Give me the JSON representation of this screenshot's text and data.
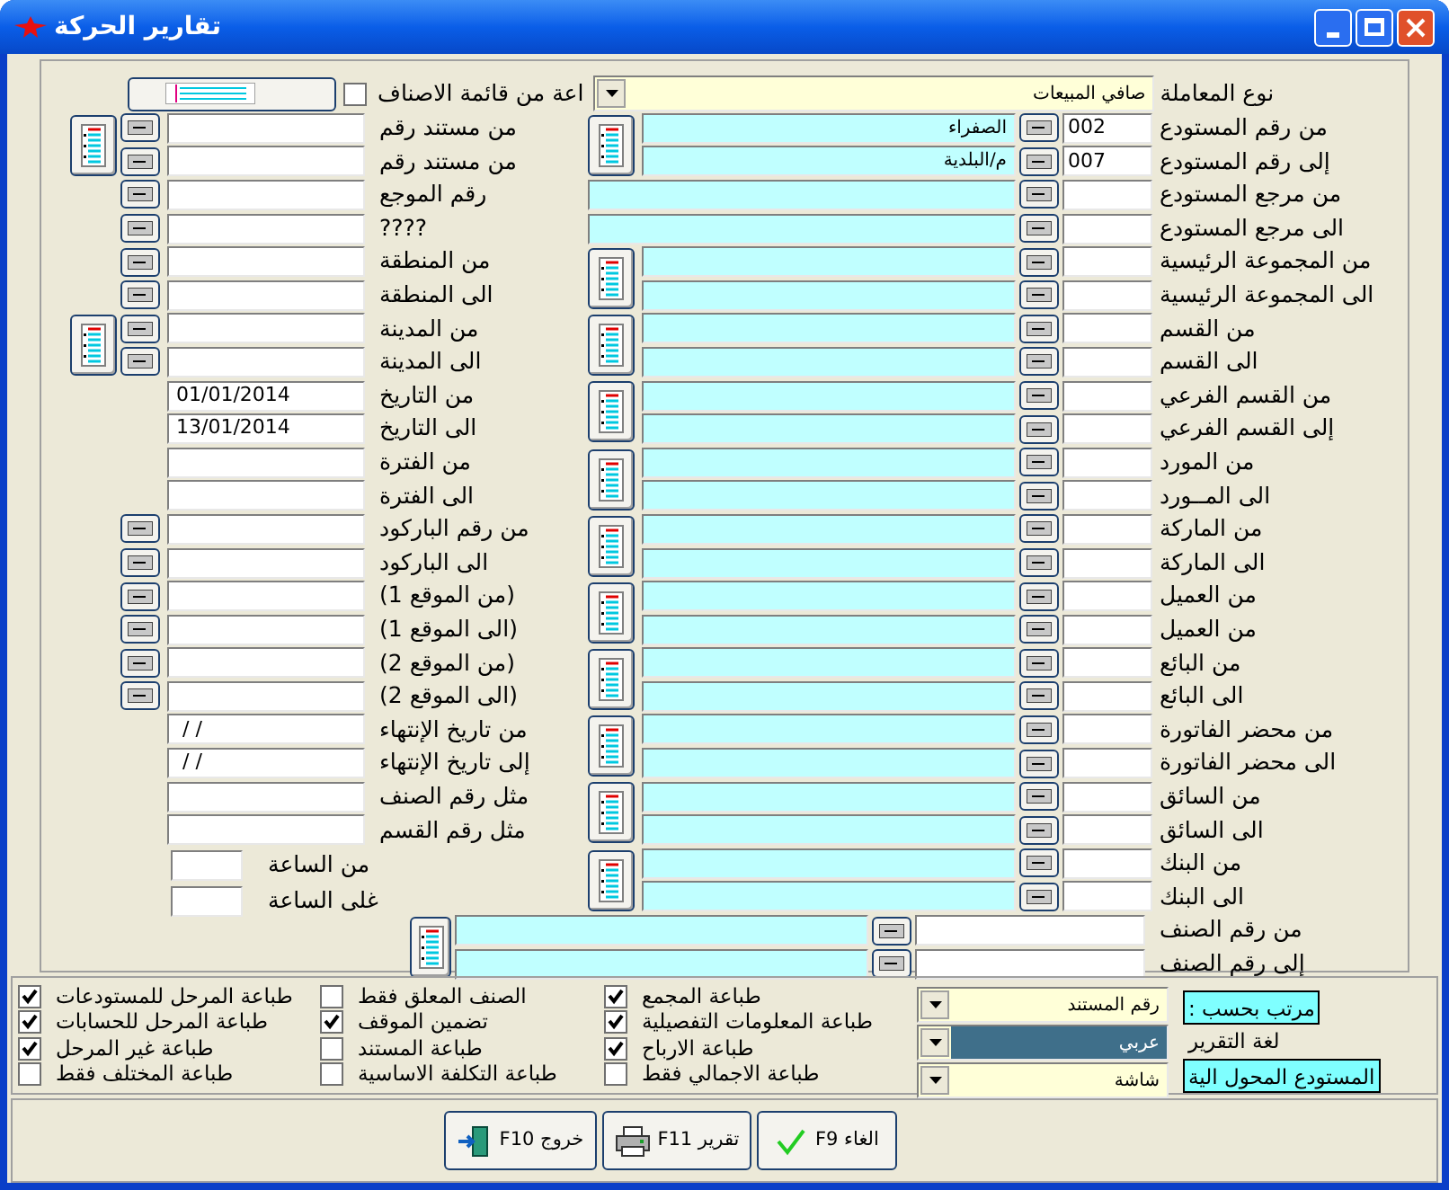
{
  "window": {
    "title": "تقارير الحركة"
  },
  "items_list": {
    "label": "اعة من قائمة الاصناف",
    "checked": false
  },
  "transaction_type": {
    "label": "نوع المعاملة",
    "value": "صافي المبيعات"
  },
  "left_groups": [
    {
      "list_button": true,
      "rows": [
        {
          "label": "من مستند رقم",
          "lookup": true
        },
        {
          "label": "من مستند رقم",
          "lookup": true
        }
      ]
    },
    {
      "list_button": false,
      "rows": [
        {
          "label": "رقم الموجع",
          "lookup": true
        },
        {
          "label": "????",
          "lookup": true
        }
      ]
    },
    {
      "list_button": false,
      "rows": [
        {
          "label": "من المنطقة",
          "lookup": true
        },
        {
          "label": "الى المنطقة",
          "lookup": true
        }
      ]
    },
    {
      "list_button": true,
      "rows": [
        {
          "label": "من المدينة",
          "lookup": true
        },
        {
          "label": "الى المدينة",
          "lookup": true
        }
      ]
    },
    {
      "list_button": false,
      "rows": [
        {
          "label": "من التاريخ",
          "lookup": false,
          "value": "01/01/2014"
        },
        {
          "label": "الى التاريخ",
          "lookup": false,
          "value": "13/01/2014"
        }
      ]
    },
    {
      "list_button": false,
      "rows": [
        {
          "label": "من الفترة",
          "lookup": false
        },
        {
          "label": "الى الفترة",
          "lookup": false
        }
      ]
    },
    {
      "list_button": false,
      "rows": [
        {
          "label": "من رقم الباركود",
          "lookup": true
        },
        {
          "label": "الى الباركود",
          "lookup": true
        }
      ]
    },
    {
      "list_button": false,
      "rows": [
        {
          "label": "(من الموقع 1)",
          "lookup": true
        },
        {
          "label": "(الى الموقع 1)",
          "lookup": true
        }
      ]
    },
    {
      "list_button": false,
      "rows": [
        {
          "label": "(من الموقع 2)",
          "lookup": true
        },
        {
          "label": "(الى الموقع 2)",
          "lookup": true
        }
      ]
    },
    {
      "list_button": false,
      "rows": [
        {
          "label": "من تاريخ الإنتهاء",
          "lookup": false,
          "value": " / /"
        },
        {
          "label": "إلى تاريخ الإنتهاء",
          "lookup": false,
          "value": " / /"
        }
      ]
    },
    {
      "list_button": false,
      "rows": [
        {
          "label": "مثل رقم الصنف",
          "lookup": false
        },
        {
          "label": "مثل رقم القسم",
          "lookup": false
        }
      ]
    }
  ],
  "hours": [
    {
      "label": "من الساعة"
    },
    {
      "label": "غلى الساعة"
    }
  ],
  "right_groups": [
    {
      "kind": "pair",
      "rows": [
        {
          "label": "من رقم المستودع",
          "code": "002",
          "name": "الصفراء"
        },
        {
          "label": "إلى رقم المستودع",
          "code": "007",
          "name": "م/البلدية"
        }
      ]
    },
    {
      "kind": "wide",
      "rows": [
        {
          "label": "من مرجع المستودع"
        },
        {
          "label": "الى مرجع المستودع"
        }
      ]
    },
    {
      "kind": "pair",
      "rows": [
        {
          "label": "من المجموعة الرئيسية"
        },
        {
          "label": "الى المجموعة الرئيسية"
        }
      ]
    },
    {
      "kind": "pair",
      "rows": [
        {
          "label": "من القسم"
        },
        {
          "label": "الى القسم"
        }
      ]
    },
    {
      "kind": "pair",
      "rows": [
        {
          "label": "من القسم الفرعي"
        },
        {
          "label": "إلى القسم الفرعي"
        }
      ]
    },
    {
      "kind": "pair",
      "rows": [
        {
          "label": "من المورد"
        },
        {
          "label": "الى المــورد"
        }
      ]
    },
    {
      "kind": "pair",
      "rows": [
        {
          "label": "من الماركة"
        },
        {
          "label": "الى الماركة"
        }
      ]
    },
    {
      "kind": "pair",
      "rows": [
        {
          "label": "من العميل"
        },
        {
          "label": "من العميل"
        }
      ]
    },
    {
      "kind": "pair",
      "rows": [
        {
          "label": "من البائع"
        },
        {
          "label": "الى البائع"
        }
      ]
    },
    {
      "kind": "pair",
      "rows": [
        {
          "label": "من محضر الفاتورة"
        },
        {
          "label": "الى محضر الفاتورة"
        }
      ]
    },
    {
      "kind": "pair",
      "rows": [
        {
          "label": "من السائق"
        },
        {
          "label": "الى السائق"
        }
      ]
    },
    {
      "kind": "pair",
      "rows": [
        {
          "label": "من البنك"
        },
        {
          "label": "الى البنك"
        }
      ]
    },
    {
      "kind": "item",
      "rows": [
        {
          "label": "من رقم الصنف"
        },
        {
          "label": "إلى رقم الصنف"
        }
      ]
    }
  ],
  "options": [
    [
      {
        "label": "طباعة المجمع",
        "checked": true
      },
      {
        "label": "طباعة المعلومات التفصيلية",
        "checked": true
      },
      {
        "label": "طباعة الارباح",
        "checked": true
      },
      {
        "label": "طباعة الاجمالي فقط",
        "checked": false
      }
    ],
    [
      {
        "label": "الصنف المعلق فقط",
        "checked": false
      },
      {
        "label": "تضمين الموقف",
        "checked": true
      },
      {
        "label": "طباعة المستند",
        "checked": false
      },
      {
        "label": "طباعة التكلفة الاساسية",
        "checked": false
      }
    ],
    [
      {
        "label": "طباعة المرحل للمستودعات",
        "checked": true
      },
      {
        "label": "طباعة المرحل للحسابات",
        "checked": true
      },
      {
        "label": "طباعة غير المرحل",
        "checked": true
      },
      {
        "label": "طباعة المختلف فقط",
        "checked": false
      }
    ]
  ],
  "selects": [
    {
      "value": "رقم المستند",
      "focused": false
    },
    {
      "value": "عربي",
      "focused": true
    },
    {
      "value": "شاشة",
      "focused": false
    }
  ],
  "select_labels": [
    {
      "label": "مرتب بحسب :",
      "highlighted": true
    },
    {
      "label": "لغة التقرير",
      "highlighted": false
    },
    {
      "label": "المستودع المحول الية",
      "highlighted": true
    }
  ],
  "buttons": [
    {
      "label": "الغاء F9",
      "kind": "cancel"
    },
    {
      "label": "تقرير F11",
      "kind": "print"
    },
    {
      "label": "خروج F10",
      "kind": "exit"
    }
  ]
}
